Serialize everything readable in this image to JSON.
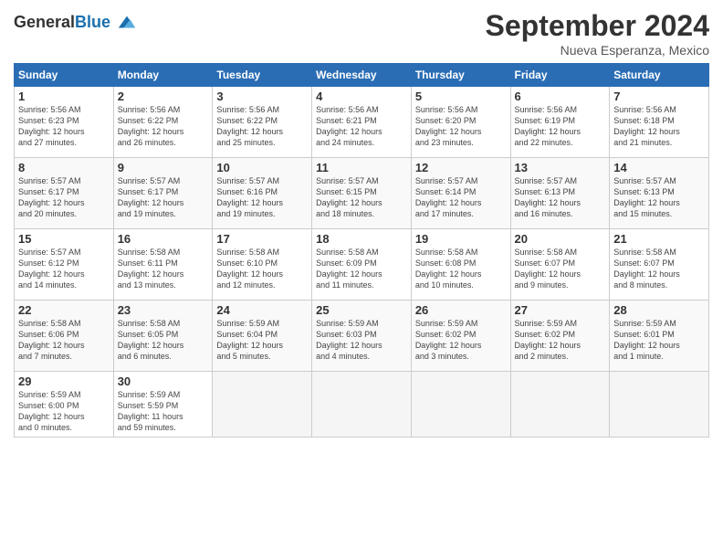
{
  "header": {
    "logo_general": "General",
    "logo_blue": "Blue",
    "month_title": "September 2024",
    "subtitle": "Nueva Esperanza, Mexico"
  },
  "weekdays": [
    "Sunday",
    "Monday",
    "Tuesday",
    "Wednesday",
    "Thursday",
    "Friday",
    "Saturday"
  ],
  "weeks": [
    [
      {
        "day": "1",
        "info": "Sunrise: 5:56 AM\nSunset: 6:23 PM\nDaylight: 12 hours\nand 27 minutes."
      },
      {
        "day": "2",
        "info": "Sunrise: 5:56 AM\nSunset: 6:22 PM\nDaylight: 12 hours\nand 26 minutes."
      },
      {
        "day": "3",
        "info": "Sunrise: 5:56 AM\nSunset: 6:22 PM\nDaylight: 12 hours\nand 25 minutes."
      },
      {
        "day": "4",
        "info": "Sunrise: 5:56 AM\nSunset: 6:21 PM\nDaylight: 12 hours\nand 24 minutes."
      },
      {
        "day": "5",
        "info": "Sunrise: 5:56 AM\nSunset: 6:20 PM\nDaylight: 12 hours\nand 23 minutes."
      },
      {
        "day": "6",
        "info": "Sunrise: 5:56 AM\nSunset: 6:19 PM\nDaylight: 12 hours\nand 22 minutes."
      },
      {
        "day": "7",
        "info": "Sunrise: 5:56 AM\nSunset: 6:18 PM\nDaylight: 12 hours\nand 21 minutes."
      }
    ],
    [
      {
        "day": "8",
        "info": "Sunrise: 5:57 AM\nSunset: 6:17 PM\nDaylight: 12 hours\nand 20 minutes."
      },
      {
        "day": "9",
        "info": "Sunrise: 5:57 AM\nSunset: 6:17 PM\nDaylight: 12 hours\nand 19 minutes."
      },
      {
        "day": "10",
        "info": "Sunrise: 5:57 AM\nSunset: 6:16 PM\nDaylight: 12 hours\nand 19 minutes."
      },
      {
        "day": "11",
        "info": "Sunrise: 5:57 AM\nSunset: 6:15 PM\nDaylight: 12 hours\nand 18 minutes."
      },
      {
        "day": "12",
        "info": "Sunrise: 5:57 AM\nSunset: 6:14 PM\nDaylight: 12 hours\nand 17 minutes."
      },
      {
        "day": "13",
        "info": "Sunrise: 5:57 AM\nSunset: 6:13 PM\nDaylight: 12 hours\nand 16 minutes."
      },
      {
        "day": "14",
        "info": "Sunrise: 5:57 AM\nSunset: 6:13 PM\nDaylight: 12 hours\nand 15 minutes."
      }
    ],
    [
      {
        "day": "15",
        "info": "Sunrise: 5:57 AM\nSunset: 6:12 PM\nDaylight: 12 hours\nand 14 minutes."
      },
      {
        "day": "16",
        "info": "Sunrise: 5:58 AM\nSunset: 6:11 PM\nDaylight: 12 hours\nand 13 minutes."
      },
      {
        "day": "17",
        "info": "Sunrise: 5:58 AM\nSunset: 6:10 PM\nDaylight: 12 hours\nand 12 minutes."
      },
      {
        "day": "18",
        "info": "Sunrise: 5:58 AM\nSunset: 6:09 PM\nDaylight: 12 hours\nand 11 minutes."
      },
      {
        "day": "19",
        "info": "Sunrise: 5:58 AM\nSunset: 6:08 PM\nDaylight: 12 hours\nand 10 minutes."
      },
      {
        "day": "20",
        "info": "Sunrise: 5:58 AM\nSunset: 6:07 PM\nDaylight: 12 hours\nand 9 minutes."
      },
      {
        "day": "21",
        "info": "Sunrise: 5:58 AM\nSunset: 6:07 PM\nDaylight: 12 hours\nand 8 minutes."
      }
    ],
    [
      {
        "day": "22",
        "info": "Sunrise: 5:58 AM\nSunset: 6:06 PM\nDaylight: 12 hours\nand 7 minutes."
      },
      {
        "day": "23",
        "info": "Sunrise: 5:58 AM\nSunset: 6:05 PM\nDaylight: 12 hours\nand 6 minutes."
      },
      {
        "day": "24",
        "info": "Sunrise: 5:59 AM\nSunset: 6:04 PM\nDaylight: 12 hours\nand 5 minutes."
      },
      {
        "day": "25",
        "info": "Sunrise: 5:59 AM\nSunset: 6:03 PM\nDaylight: 12 hours\nand 4 minutes."
      },
      {
        "day": "26",
        "info": "Sunrise: 5:59 AM\nSunset: 6:02 PM\nDaylight: 12 hours\nand 3 minutes."
      },
      {
        "day": "27",
        "info": "Sunrise: 5:59 AM\nSunset: 6:02 PM\nDaylight: 12 hours\nand 2 minutes."
      },
      {
        "day": "28",
        "info": "Sunrise: 5:59 AM\nSunset: 6:01 PM\nDaylight: 12 hours\nand 1 minute."
      }
    ],
    [
      {
        "day": "29",
        "info": "Sunrise: 5:59 AM\nSunset: 6:00 PM\nDaylight: 12 hours\nand 0 minutes."
      },
      {
        "day": "30",
        "info": "Sunrise: 5:59 AM\nSunset: 5:59 PM\nDaylight: 11 hours\nand 59 minutes."
      },
      {
        "day": "",
        "info": ""
      },
      {
        "day": "",
        "info": ""
      },
      {
        "day": "",
        "info": ""
      },
      {
        "day": "",
        "info": ""
      },
      {
        "day": "",
        "info": ""
      }
    ]
  ]
}
